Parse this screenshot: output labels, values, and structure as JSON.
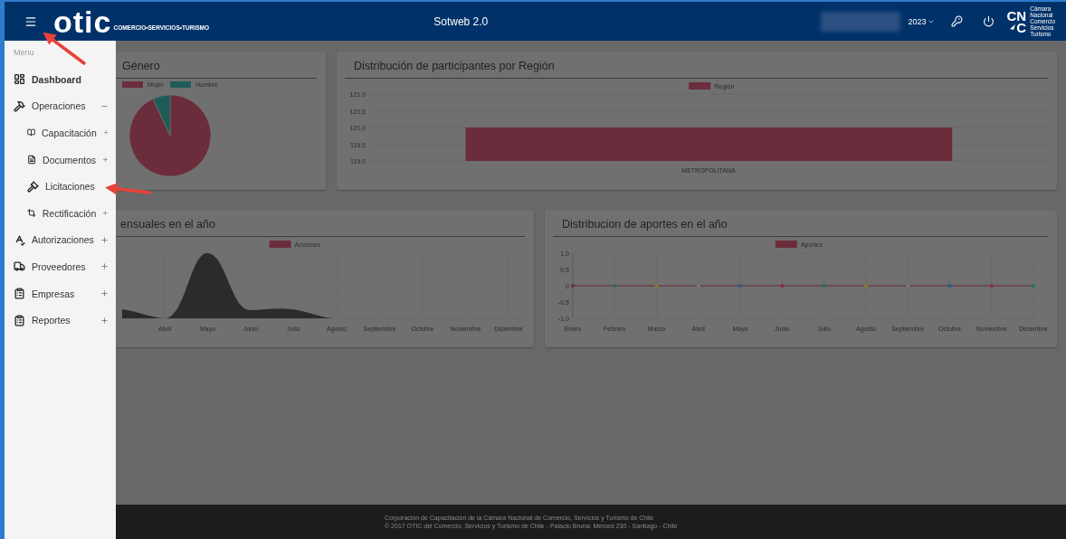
{
  "top_bar": {
    "logo": {
      "word": "otic",
      "tagline": "COMERCIO•SERVICIOS•TURISMO"
    },
    "title": "Sotweb 2.0",
    "year_select": {
      "value": "2023"
    },
    "partner_logo": {
      "letters_top": "CN",
      "letters_bottom": "C",
      "caption": [
        "Cámara",
        "Nacional",
        "Comercio",
        "Servicios",
        "Turismo"
      ]
    }
  },
  "sidebar": {
    "heading": "Menu",
    "items": [
      {
        "label": "Dashboard",
        "kind": "link",
        "selected": true
      },
      {
        "label": "Operaciones",
        "kind": "group",
        "selected": false,
        "expanded": true,
        "children": [
          {
            "label": "Capacitación",
            "kind": "group",
            "selected": false,
            "expanded": false
          },
          {
            "label": "Documentos",
            "kind": "group",
            "selected": false,
            "expanded": false
          },
          {
            "label": "Licitaciones",
            "kind": "link",
            "selected": false
          },
          {
            "label": "Rectificación",
            "kind": "group",
            "selected": false,
            "expanded": false
          }
        ]
      },
      {
        "label": "Autorizaciones",
        "kind": "group",
        "selected": false,
        "expanded": false
      },
      {
        "label": "Proveedores",
        "kind": "group",
        "selected": false,
        "expanded": false
      },
      {
        "label": "Empresas",
        "kind": "group",
        "selected": false,
        "expanded": false
      },
      {
        "label": "Reportes",
        "kind": "group",
        "selected": false,
        "expanded": false
      }
    ]
  },
  "cards": [
    {
      "kind": "pie",
      "title": "Género",
      "legend": [
        {
          "label": "Mujer",
          "color": "#6b2d3b"
        },
        {
          "label": "Hombre",
          "color": "#1f5c58"
        }
      ]
    },
    {
      "title": "Distribución de participantes por Región",
      "chart_data": {
        "type": "bar",
        "categories": [
          "METROPOLITANA"
        ],
        "series": [
          {
            "name": "Región",
            "color": "#6b2d3b",
            "values": [
              120
            ]
          }
        ],
        "ylim": [
          119,
          121
        ],
        "yticks": [
          {
            "value": 119,
            "label": "119.0"
          },
          {
            "value": 119.5,
            "label": "119.5"
          },
          {
            "value": 120,
            "label": "120.0"
          },
          {
            "value": 120.5,
            "label": "120.5"
          },
          {
            "value": 121,
            "label": "121.0"
          }
        ]
      }
    },
    {
      "kind": "area",
      "title": "ensuales en el año",
      "legend": [
        {
          "label": "Acciones",
          "color": "#6b2d3b"
        }
      ],
      "x_labels": [
        "Abril",
        "Mayo",
        "Junio",
        "Julio",
        "Agosto",
        "Septiembre",
        "Octubre",
        "Noviembre",
        "Diciembre"
      ]
    },
    {
      "title": "Distribucion de aportes en el año",
      "chart_data": {
        "type": "line",
        "categories": [
          "Enero",
          "Febrero",
          "Marzo",
          "Abril",
          "Mayo",
          "Junio",
          "Julio",
          "Agosto",
          "Septiembre",
          "Octubre",
          "Noviembre",
          "Diciembre"
        ],
        "series": [
          {
            "name": "Aportes",
            "color": "#6b2d3b",
            "values": [
              0,
              0,
              0,
              0,
              0,
              0,
              0,
              0,
              0,
              0,
              0,
              0
            ]
          }
        ],
        "ylim": [
          -1,
          1
        ],
        "yticks": [
          {
            "value": -1,
            "label": "-1.0"
          },
          {
            "value": -0.5,
            "label": "-0.5"
          },
          {
            "value": 0,
            "label": "0"
          },
          {
            "value": 0.5,
            "label": "0.5"
          },
          {
            "value": 1,
            "label": "1.0"
          }
        ]
      }
    }
  ],
  "footer": {
    "lines": [
      "Corporación de Capacitación de la Cámara Nacional de Comercio, Servicios y Turismo de Chile",
      "© 2017 OTIC del Comercio, Servicios y Turismo de Chile - Palacio Bruna: Merced 230 - Santiago - Chile"
    ]
  }
}
